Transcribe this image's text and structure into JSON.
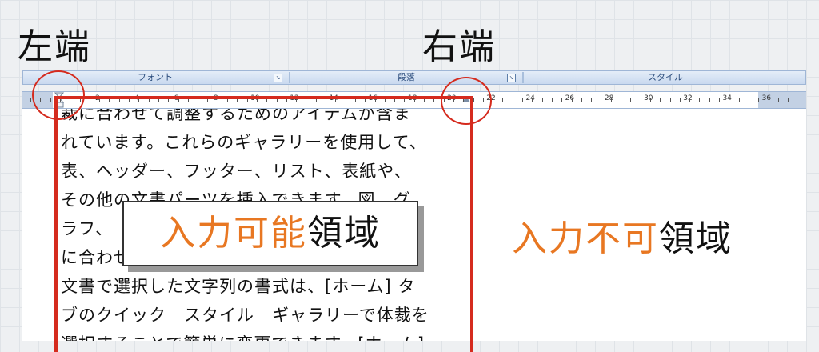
{
  "headings": {
    "left": "左端",
    "right": "右端"
  },
  "ribbon": {
    "groups": [
      {
        "label": "フォント",
        "launcher": "↘"
      },
      {
        "label": "段落",
        "launcher": "↘"
      },
      {
        "label": "スタイル"
      }
    ]
  },
  "ruler": {
    "numbers": [
      "2",
      "4",
      "6",
      "8",
      "10",
      "12",
      "14",
      "16",
      "18",
      "20",
      "22",
      "24",
      "26",
      "28",
      "30",
      "32",
      "34",
      "36"
    ]
  },
  "document": {
    "lines": [
      "裁に合わせて調整するためのアイテムが含ま",
      "れています。これらのギャラリーを使用して、",
      "表、ヘッダー、フッター、リスト、表紙や、",
      "その他の文書パーツを挿入できます。図、グ",
      "ラフ、　　　　　　　　　　　　　　　体裁",
      "に合わせ",
      "文書で選択した文字列の書式は、[ホーム] タ",
      "ブのクイック　スタイル　ギャラリーで体裁を",
      "選択することで簡単に変更できます。[ホーム]"
    ]
  },
  "annotations": {
    "editable_area": {
      "part1": "入力可能",
      "part2": "領域"
    },
    "non_editable_area": {
      "part1": "入力不可",
      "part2": "領域"
    }
  },
  "colors": {
    "accent": "#e87722",
    "marker": "#d52b1e",
    "text": "#111111"
  }
}
